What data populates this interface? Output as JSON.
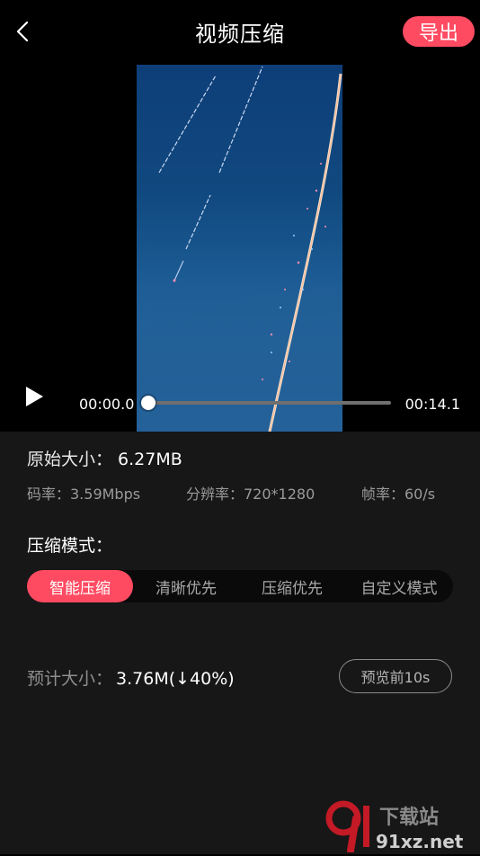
{
  "header": {
    "title": "视频压缩",
    "export_label": "导出",
    "back_icon": "chevron-left-icon",
    "accent_color": "#ff4b62"
  },
  "player": {
    "current_time": "00:00.0",
    "total_time": "00:14.1",
    "progress": 0.0,
    "play_icon": "play-icon"
  },
  "info": {
    "original_size_label": "原始大小：",
    "original_size_value": "6.27MB",
    "bitrate": "码率：3.59Mbps",
    "resolution": "分辨率：720*1280",
    "framerate": "帧率：60/s"
  },
  "compression": {
    "mode_title": "压缩模式：",
    "modes": [
      {
        "label": "智能压缩",
        "active": true
      },
      {
        "label": "清晰优先",
        "active": false
      },
      {
        "label": "压缩优先",
        "active": false
      },
      {
        "label": "自定义模式",
        "active": false
      }
    ]
  },
  "estimate": {
    "label": "预计大小：",
    "value": "3.76M(↓40%)",
    "preview_label": "预览前10s"
  },
  "watermark": {
    "logo_text": "91xz.net",
    "logo_subtext": "下载站"
  }
}
